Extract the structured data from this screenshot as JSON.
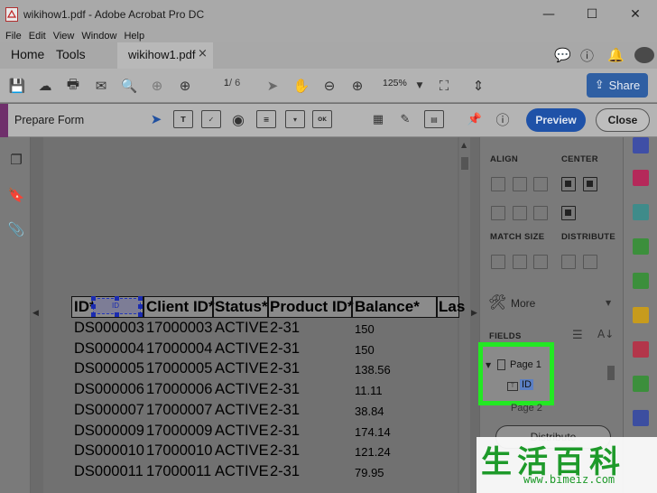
{
  "window": {
    "title": "wikihow1.pdf - Adobe Acrobat Pro DC",
    "minimize": "—",
    "maximize": "☐",
    "close": "✕"
  },
  "menu": [
    "File",
    "Edit",
    "View",
    "Window",
    "Help"
  ],
  "tabs": {
    "home": "Home",
    "tools": "Tools",
    "doc": "wikihow1.pdf",
    "close": "×"
  },
  "toolbar": {
    "page_current": "1",
    "page_total": "/ 6",
    "zoom": "125%",
    "share_label": "Share"
  },
  "prepare_form": {
    "label": "Prepare Form",
    "preview_label": "Preview",
    "close_label": "Close"
  },
  "table": {
    "headers": [
      "ID*",
      "Client ID*",
      "Status*",
      "Product ID*",
      "Balance*",
      "Las"
    ],
    "id_field_label": "ID",
    "rows": [
      [
        "DS000003",
        "17000003",
        "ACTIVE",
        "2-31",
        "150"
      ],
      [
        "DS000004",
        "17000004",
        "ACTIVE",
        "2-31",
        "150"
      ],
      [
        "DS000005",
        "17000005",
        "ACTIVE",
        "2-31",
        "138.56"
      ],
      [
        "DS000006",
        "17000006",
        "ACTIVE",
        "2-31",
        "11.11"
      ],
      [
        "DS000007",
        "17000007",
        "ACTIVE",
        "2-31",
        "38.84"
      ],
      [
        "DS000009",
        "17000009",
        "ACTIVE",
        "2-31",
        "174.14"
      ],
      [
        "DS000010",
        "17000010",
        "ACTIVE",
        "2-31",
        "121.24"
      ],
      [
        "DS000011",
        "17000011",
        "ACTIVE",
        "2-31",
        "79.95"
      ]
    ]
  },
  "right_panel": {
    "align": "ALIGN",
    "center": "CENTER",
    "match_size": "MATCH SIZE",
    "distribute": "DISTRIBUTE",
    "more": "More",
    "fields": "FIELDS",
    "page1": "Page 1",
    "field_id": "ID",
    "page2": "Page 2",
    "distribute_button": "Distribute"
  },
  "watermark": {
    "chars": "生活百科",
    "url": "www.bimeiz.com"
  },
  "colors": {
    "accent_green": "#23e823",
    "preview_blue": "#1f52a8",
    "share_blue": "#2f5fa3"
  }
}
